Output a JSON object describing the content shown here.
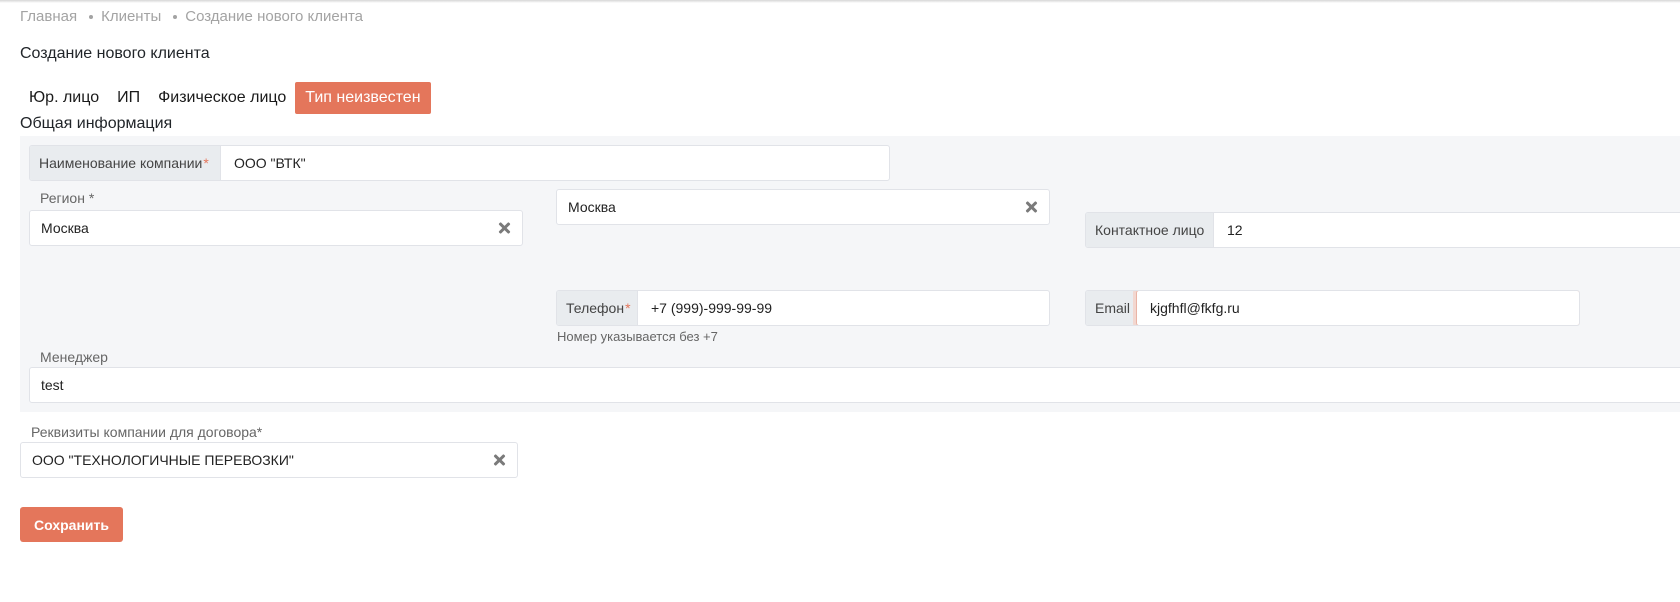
{
  "breadcrumb": {
    "items": [
      "Главная",
      "Клиенты",
      "Создание нового клиента"
    ]
  },
  "page_title": "Создание нового клиента",
  "tabs": [
    {
      "label": "Юр. лицо",
      "active": false
    },
    {
      "label": "ИП",
      "active": false
    },
    {
      "label": "Физическое лицо",
      "active": false
    },
    {
      "label": "Тип неизвестен",
      "active": true
    }
  ],
  "section_title": "Общая информация",
  "form": {
    "company_name": {
      "label": "Наименование компании",
      "required_mark": "*",
      "value": "ООО \"ВТК\""
    },
    "region": {
      "label": "Регион *",
      "value": "Москва"
    },
    "city": {
      "value": "Москва"
    },
    "contact_person": {
      "label": "Контактное лицо",
      "value": "12"
    },
    "phone": {
      "label": "Телефон",
      "required_mark": "*",
      "value": "+7 (999)-999-99-99",
      "hint": "Номер указывается без +7"
    },
    "email": {
      "label": "Email",
      "value": "kjgfhfl@fkfg.ru"
    },
    "manager": {
      "label": "Менеджер",
      "value": "test"
    },
    "requisites": {
      "label": "Реквизиты компании для договора*",
      "value": "ООО \"ТЕХНОЛОГИЧНЫЕ ПЕРЕВОЗКИ\""
    }
  },
  "save_label": "Сохранить",
  "colors": {
    "accent": "#e4765b",
    "panel": "#f5f6f8"
  }
}
